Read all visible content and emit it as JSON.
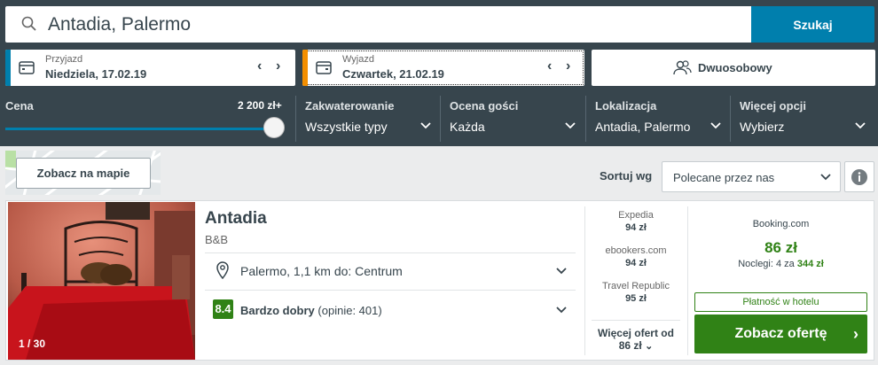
{
  "search": {
    "value": "Antadia, Palermo",
    "button": "Szukaj"
  },
  "checkin": {
    "label": "Przyjazd",
    "date": "Niedziela, 17.02.19"
  },
  "checkout": {
    "label": "Wyjazd",
    "date": "Czwartek, 21.02.19"
  },
  "guests": {
    "label": "Dwuosobowy"
  },
  "filters": {
    "price": {
      "label": "Cena",
      "value": "2 200 zł+",
      "level": 1.0
    },
    "accommodation": {
      "label": "Zakwaterowanie",
      "value": "Wszystkie typy"
    },
    "rating": {
      "label": "Ocena gości",
      "value": "Każda"
    },
    "location": {
      "label": "Lokalizacja",
      "value": "Antadia, Palermo"
    },
    "more": {
      "label": "Więcej opcji",
      "value": "Wybierz"
    }
  },
  "map_button": "Zobacz na mapie",
  "sort": {
    "label": "Sortuj wg",
    "value": "Polecane przez nas"
  },
  "colors": {
    "accent": "#007fad",
    "green": "#308216",
    "orange": "#f48f00",
    "header": "#37454d"
  },
  "hotel": {
    "name": "Antadia",
    "type": "B&B",
    "photo_count": "1 / 30",
    "location": "Palermo, 1,1 km do: Centrum",
    "rating_score": "8.4",
    "rating_text": "Bardzo dobry",
    "rating_count": "(opinie: 401)",
    "deals": [
      {
        "site": "Expedia",
        "price": "94 zł"
      },
      {
        "site": "ebookers.com",
        "price": "94 zł"
      },
      {
        "site": "Travel Republic",
        "price": "95 zł"
      }
    ],
    "more_deals": "Więcej ofert od",
    "more_deals_price": "86 zł",
    "best": {
      "site": "Booking.com",
      "price": "86 zł",
      "nights_label": "Noclegi: 4 za",
      "total": "344 zł"
    },
    "pay_at_hotel": "Płatność w hotelu",
    "cta": "Zobacz ofertę"
  }
}
